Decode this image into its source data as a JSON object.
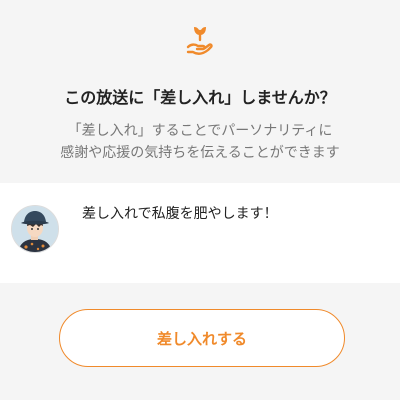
{
  "header": {
    "icon": "gift-hand-icon",
    "title": "この放送に「差し入れ」しませんか？",
    "description_line1": "「差し入れ」することでパーソナリティに",
    "description_line2": "感謝や応援の気持ちを伝えることができます"
  },
  "message": {
    "avatar": "user-avatar",
    "text": "差し入れで私腹を肥やします！"
  },
  "actions": {
    "submit_label": "差し入れする"
  },
  "colors": {
    "accent": "#f08a2b",
    "background": "#f5f5f5",
    "text": "#222222",
    "muted": "#777777"
  }
}
